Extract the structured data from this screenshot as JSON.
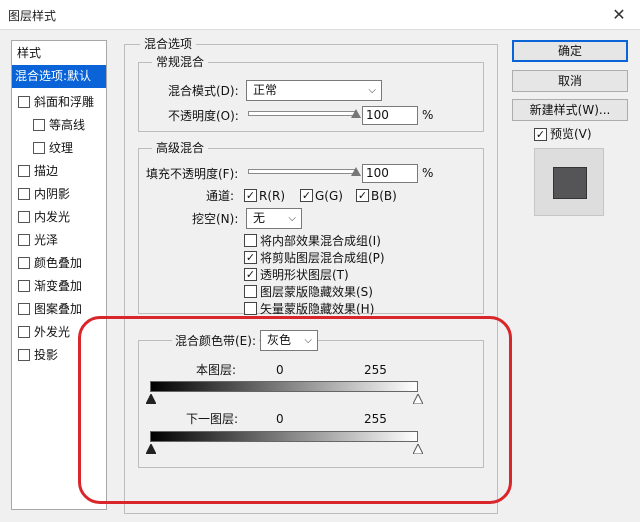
{
  "window": {
    "title": "图层样式",
    "close_glyph": "✕"
  },
  "sidebar": {
    "items": [
      {
        "label": "样式",
        "checkbox": false,
        "selected": false
      },
      {
        "label": "混合选项:默认",
        "checkbox": false,
        "selected": true
      },
      {
        "label": "斜面和浮雕",
        "checkbox": true,
        "selected": false
      },
      {
        "label": "等高线",
        "checkbox": true,
        "selected": false
      },
      {
        "label": "纹理",
        "checkbox": true,
        "selected": false
      },
      {
        "label": "描边",
        "checkbox": true,
        "selected": false
      },
      {
        "label": "内阴影",
        "checkbox": true,
        "selected": false
      },
      {
        "label": "内发光",
        "checkbox": true,
        "selected": false
      },
      {
        "label": "光泽",
        "checkbox": true,
        "selected": false
      },
      {
        "label": "颜色叠加",
        "checkbox": true,
        "selected": false
      },
      {
        "label": "渐变叠加",
        "checkbox": true,
        "selected": false
      },
      {
        "label": "图案叠加",
        "checkbox": true,
        "selected": false
      },
      {
        "label": "外发光",
        "checkbox": true,
        "selected": false
      },
      {
        "label": "投影",
        "checkbox": true,
        "selected": false
      }
    ]
  },
  "blend_options": {
    "title": "混合选项",
    "general": {
      "title": "常规混合",
      "mode_label": "混合模式(D):",
      "mode_value": "正常",
      "opacity_label": "不透明度(O):",
      "opacity_value": "100",
      "opacity_level": 1.0,
      "percent": "%"
    },
    "advanced": {
      "title": "高级混合",
      "fill_label": "填充不透明度(F):",
      "fill_value": "100",
      "fill_level": 1.0,
      "percent": "%",
      "channels_label": "通道:",
      "channel_r": "R(R)",
      "channel_g": "G(G)",
      "channel_b": "B(B)",
      "knockout_label": "挖空(N):",
      "knockout_value": "无",
      "options": [
        {
          "label": "将内部效果混合成组(I)",
          "checked": false
        },
        {
          "label": "将剪贴图层混合成组(P)",
          "checked": true
        },
        {
          "label": "透明形状图层(T)",
          "checked": true
        },
        {
          "label": "图层蒙版隐藏效果(S)",
          "checked": false
        },
        {
          "label": "矢量蒙版隐藏效果(H)",
          "checked": false
        }
      ]
    },
    "blend_if": {
      "label": "混合颜色带(E):",
      "value": "灰色",
      "this_layer_label": "本图层:",
      "this_layer_min": "0",
      "this_layer_max": "255",
      "underlying_label": "下一图层:",
      "underlying_min": "0",
      "underlying_max": "255"
    }
  },
  "buttons": {
    "ok": "确定",
    "cancel": "取消",
    "new_style": "新建样式(W)...",
    "preview": "预览(V)"
  },
  "colors": {
    "accent": "#0a64d8",
    "highlight": "#d8262b",
    "swatch": "#555558"
  },
  "icons": {
    "check": "✓",
    "chevron": "⌵"
  }
}
